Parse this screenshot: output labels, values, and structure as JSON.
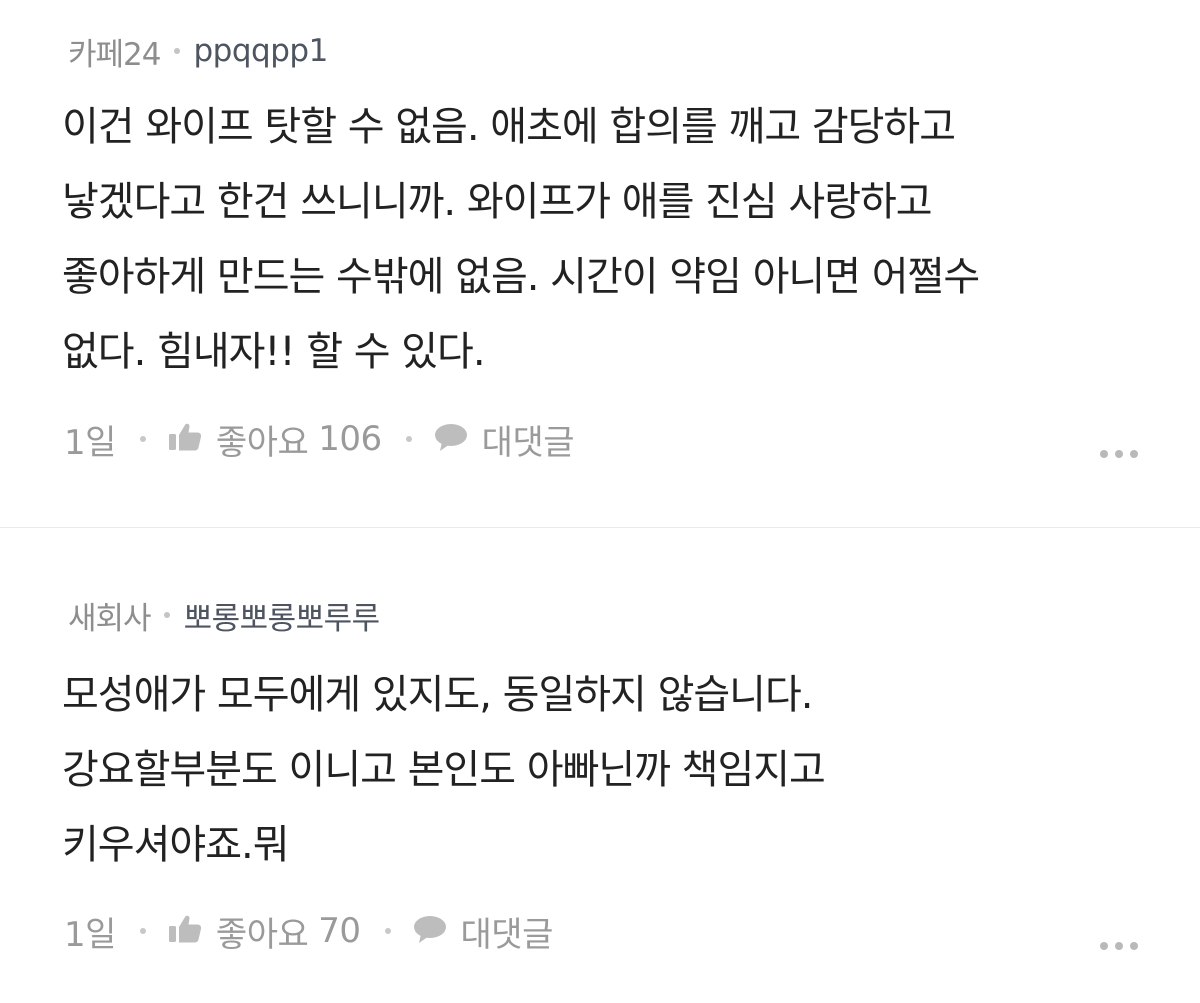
{
  "comments": [
    {
      "cafe": "카페24",
      "user": "ppqqpp1",
      "lines": [
        "이건 와이프 탓할 수 없음. 애초에 합의를 깨고 감당하고",
        "낳겠다고 한건 쓰니니까. 와이프가 애를 진심 사랑하고",
        "좋아하게 만드는 수밖에 없음. 시간이 약임 아니면 어쩔수",
        "없다. 힘내자!! 할 수 있다."
      ],
      "time": "1일",
      "like_label": "좋아요",
      "like_count": "106",
      "reply_label": "대댓글",
      "like_icon": "thumbs-up-icon",
      "reply_icon": "speech-bubble-icon",
      "more_icon": "more-horizontal-icon"
    },
    {
      "cafe": "새회사",
      "user": "뽀롱뽀롱뽀루루",
      "lines": [
        "모성애가 모두에게 있지도, 동일하지 않습니다.",
        "강요할부분도 이니고 본인도 아빠닌까 책임지고",
        "키우셔야죠.뭐"
      ],
      "time": "1일",
      "like_label": "좋아요",
      "like_count": "70",
      "reply_label": "대댓글",
      "like_icon": "thumbs-up-icon",
      "reply_icon": "speech-bubble-icon",
      "more_icon": "more-horizontal-icon"
    }
  ],
  "colors": {
    "text": "#222222",
    "meta": "#8e8e8e",
    "username": "#4e5560",
    "action": "#9a9a9a",
    "divider": "#e9e9e9"
  }
}
